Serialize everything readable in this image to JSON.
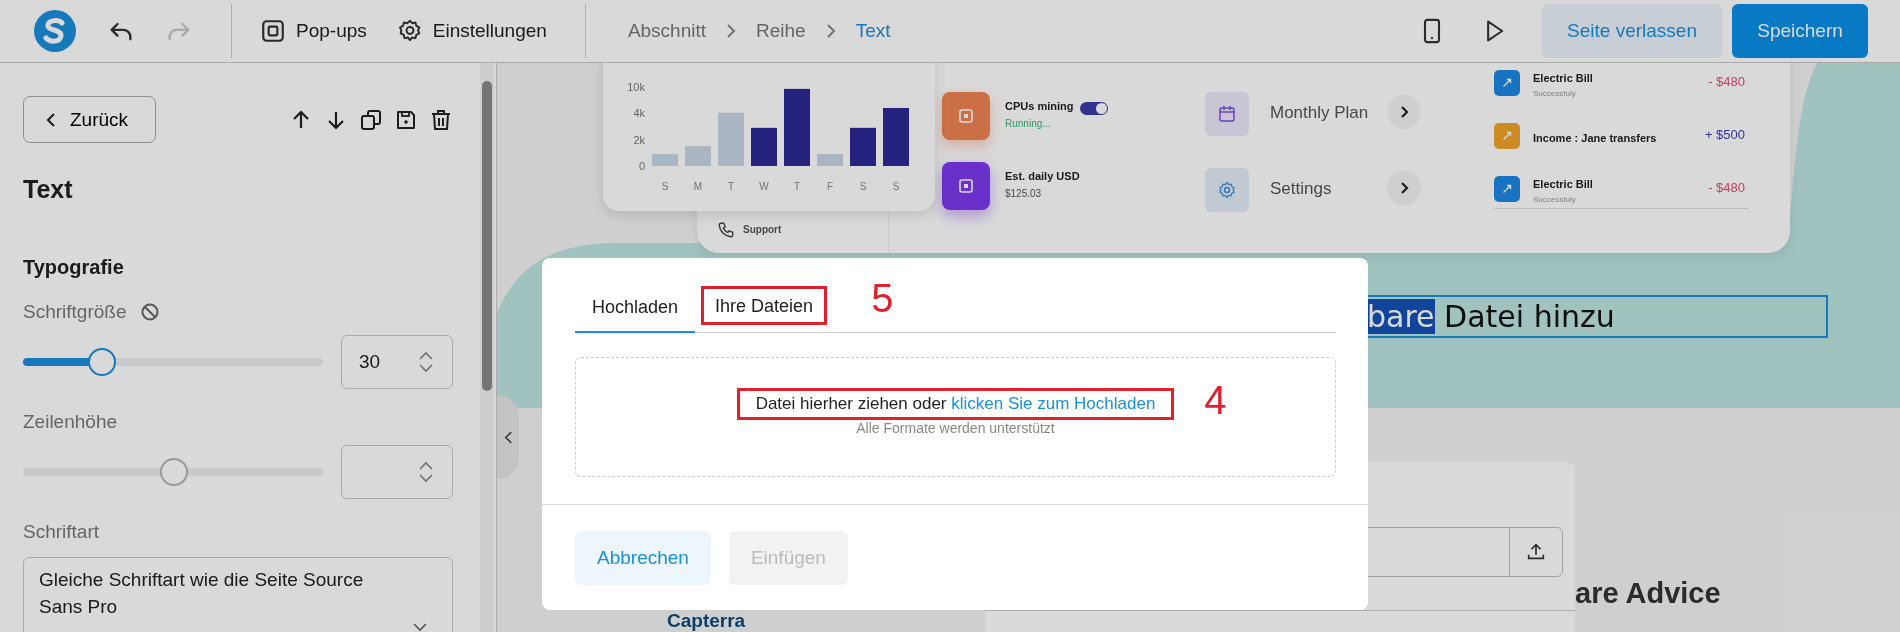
{
  "topbar": {
    "undo_enabled": true,
    "redo_enabled": false,
    "tools": [
      {
        "label": "Pop-ups",
        "kind": "popup"
      },
      {
        "label": "Einstellungen",
        "kind": "settings"
      }
    ],
    "breadcrumb": [
      {
        "label": "Abschnitt",
        "selected": false
      },
      {
        "label": "Reihe",
        "selected": false
      },
      {
        "label": "Text",
        "selected": true
      }
    ],
    "actions": [
      {
        "label": "Seite verlassen",
        "kind": "secondary"
      },
      {
        "label": "Speichern",
        "kind": "primary"
      }
    ]
  },
  "panel": {
    "back": "Zurück",
    "title": "Text",
    "section": "Typografie",
    "font_size": {
      "label": "Schriftgröße",
      "level": 0.26,
      "value": "30",
      "disabled": false
    },
    "line_height": {
      "label": "Zeilenhöhe",
      "level": 0.5,
      "disabled": true
    },
    "font_family": {
      "label": "Schriftart",
      "value": "Gleiche Schriftart wie die Seite Source Sans Pro"
    }
  },
  "preview": {
    "chart": {
      "axis_labels": [
        "10k",
        "4k",
        "2k",
        "0"
      ],
      "day_labels": [
        "S",
        "M",
        "T",
        "W",
        "T",
        "F",
        "S",
        "S"
      ]
    },
    "support": "Support",
    "status": [
      {
        "title": "CPUs mining",
        "detail": "Running...",
        "kind": "toggle",
        "on": true
      },
      {
        "title": "Est. daily USD",
        "detail": "$125.03",
        "kind": "value"
      }
    ],
    "menu": [
      {
        "label": "Monthly Plan",
        "kind": "calendar"
      },
      {
        "label": "Settings",
        "kind": "settings"
      }
    ],
    "transactions": [
      {
        "title": "Electric Bill",
        "subtitle": "Successfuly",
        "amount": "- $480",
        "kind": "expense"
      },
      {
        "title": "Income : Jane transfers",
        "amount": "+ $500",
        "kind": "income"
      },
      {
        "title": "Electric Bill",
        "subtitle": "Successfuly",
        "amount": "- $480",
        "kind": "expense"
      }
    ],
    "selected_text": "bare",
    "text": "Datei hinzu",
    "logos": [
      "Capterra",
      "are Advice"
    ]
  },
  "modal": {
    "tabs": [
      {
        "label": "Hochladen",
        "selected": true
      },
      {
        "label": "Ihre Dateien",
        "selected": false,
        "annotation": "5"
      }
    ],
    "drop": {
      "text": "Datei hierher ziehen oder ",
      "link": "klicken Sie zum Hochladen",
      "hint": "Alle Formate werden unterstützt",
      "annotation": "4"
    },
    "buttons": [
      {
        "label": "Abbrechen",
        "disabled": false
      },
      {
        "label": "Einfügen",
        "disabled": true
      }
    ]
  }
}
